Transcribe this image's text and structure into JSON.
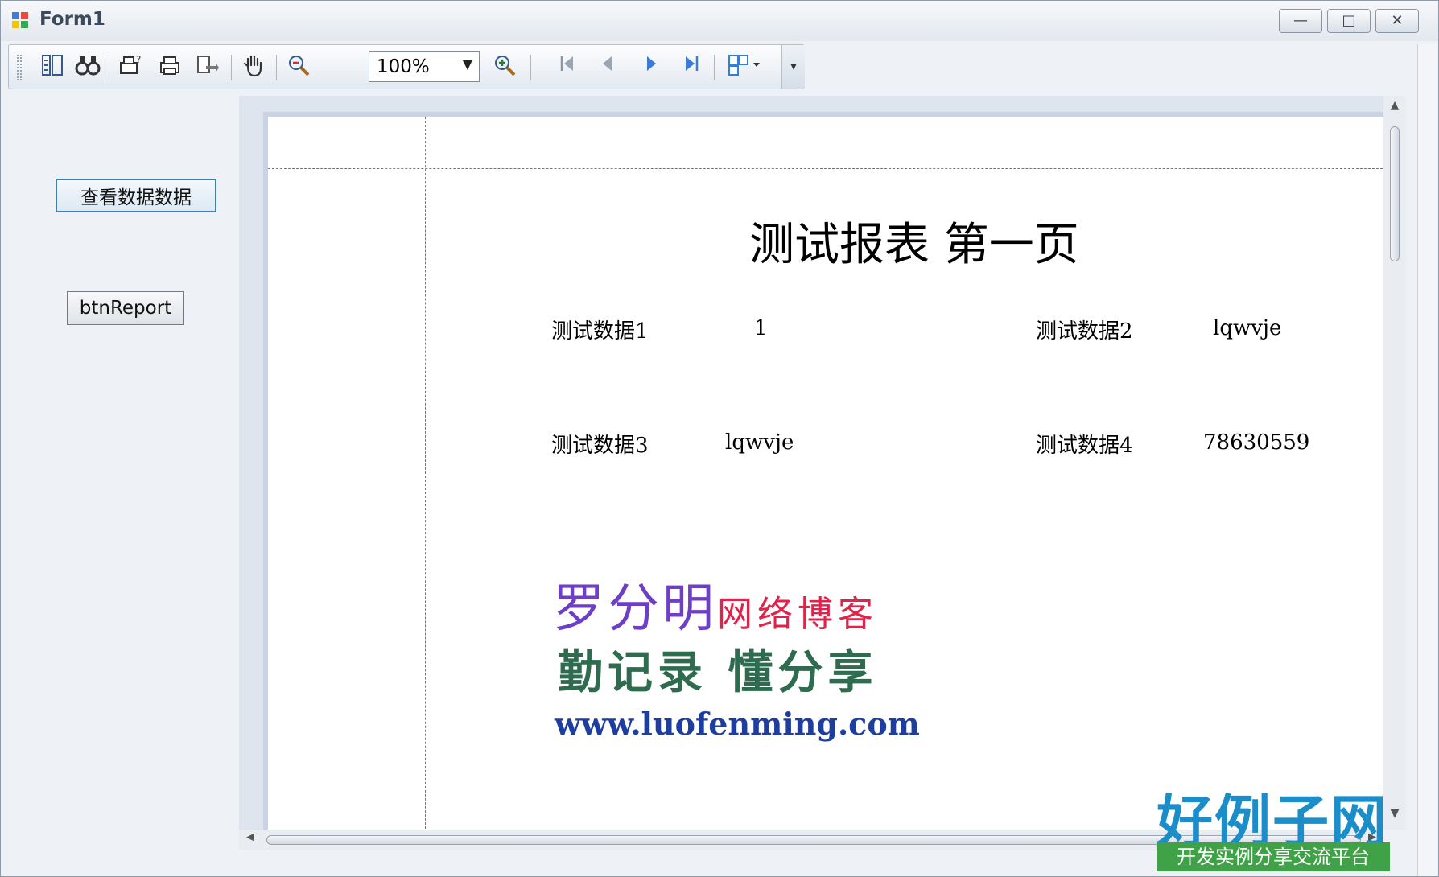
{
  "window": {
    "title": "Form1",
    "controls": {
      "minimize": "—",
      "maximize": "□",
      "close": "✕"
    }
  },
  "toolbar": {
    "icons": [
      "document-map-icon",
      "find-icon",
      "page-setup-icon",
      "print-icon",
      "export-icon",
      "hand-pan-icon",
      "zoom-out-icon",
      "zoom-in-icon",
      "first-page-icon",
      "previous-page-icon",
      "next-page-icon",
      "last-page-icon",
      "multi-page-icon"
    ],
    "zoom_value": "100%",
    "overflow": "▾"
  },
  "sidebar": {
    "view_button": "查看数据数据",
    "report_button": "btnReport"
  },
  "report": {
    "title": "测试报表  第一页",
    "rows": [
      {
        "label1": "测试数据1",
        "value1": "1",
        "label2": "测试数据2",
        "value2": "lqwvje"
      },
      {
        "label1": "测试数据3",
        "value1": "lqwvje",
        "label2": "测试数据4",
        "value2": "78630559"
      }
    ],
    "logo": {
      "line1_a": "罗分明",
      "line1_b": "网络博客",
      "line2": "勤记录 懂分享",
      "url": "www.luofenming.com"
    }
  },
  "brand": {
    "name": "好例子网",
    "tagline": "开发实例分享交流平台"
  },
  "colors": {
    "logo_purple": "#6d3fc6",
    "logo_red": "#e0234a",
    "logo_green": "#2f6b4e",
    "logo_blue": "#1d3e9e",
    "brand_blue": "#1b8dc8",
    "brand_green": "#3fa247"
  }
}
